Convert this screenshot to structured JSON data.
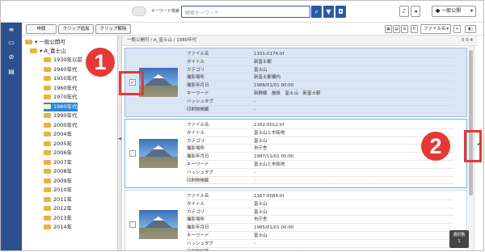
{
  "topbar": {
    "keyword_toggle_label": "キーワード検索",
    "search_placeholder": "検索キーワード",
    "user_label": "一般公開"
  },
  "toolbar": {
    "apply_label": "申請",
    "clip_add_label": "クリップ追加",
    "clip_remove_label": "クリップ解除",
    "sort_label": "ファイル名"
  },
  "tree": {
    "root": "一般公開可",
    "parent": "A_富士山",
    "folders": [
      "1930年以前",
      "1940年代",
      "1950年代",
      "1960年代",
      "1970年代",
      "1980年代",
      "1990年代",
      "2000年代",
      "2004年",
      "2005年",
      "2006年",
      "2007年",
      "2008年",
      "2009年",
      "2010年",
      "2011年",
      "2012年",
      "2013年",
      "2014年"
    ],
    "selected": "1980年代"
  },
  "breadcrumb": {
    "text": "一般公開可 / A_富士山 / 1980年代",
    "counts": "0  0  4"
  },
  "items": [
    {
      "checked": "✓",
      "fields": [
        [
          "ファイル名",
          "1101-0174.tif"
        ],
        [
          "タイトル",
          "新富士駅"
        ],
        [
          "カテゴリ",
          "富士山"
        ],
        [
          "撮影場所",
          "新富士駅構内"
        ],
        [
          "撮影年月日",
          "1988/01/01 00:00"
        ],
        [
          "キーワード",
          "新幹線　施設　富士山　新富士駅"
        ],
        [
          "ハッシュタグ",
          "-"
        ],
        [
          "印刷物掲載",
          "-"
        ]
      ]
    },
    {
      "checked": "",
      "fields": [
        [
          "ファイル名",
          "1162-0012.tif"
        ],
        [
          "タイトル",
          "富士山と市街地"
        ],
        [
          "カテゴリ",
          "富士山"
        ],
        [
          "撮影場所",
          "市庁舎"
        ],
        [
          "撮影年月日",
          "1987/11/01 00:00"
        ],
        [
          "キーワード",
          "富士山と市街地"
        ],
        [
          "ハッシュタグ",
          "-"
        ],
        [
          "印刷物掲載",
          "-"
        ]
      ]
    },
    {
      "checked": "",
      "fields": [
        [
          "ファイル名",
          "1167-0084.tif"
        ],
        [
          "タイトル",
          "富士山"
        ],
        [
          "カテゴリ",
          "富士山"
        ],
        [
          "撮影場所",
          "市庁舎"
        ],
        [
          "撮影年月日",
          "1985/01/01 00:00"
        ],
        [
          "キーワード",
          "富士山"
        ],
        [
          "ハッシュタグ",
          "-"
        ],
        [
          "印刷物掲載",
          "-"
        ]
      ]
    }
  ],
  "selection_badge": {
    "label": "選択数",
    "count": "1"
  },
  "markers": [
    "1",
    "2"
  ],
  "colors": {
    "accent": "#2a5aa6",
    "selected_folder": "#2b86d9",
    "marker": "#e53935",
    "nav": "#2d4f8f"
  }
}
